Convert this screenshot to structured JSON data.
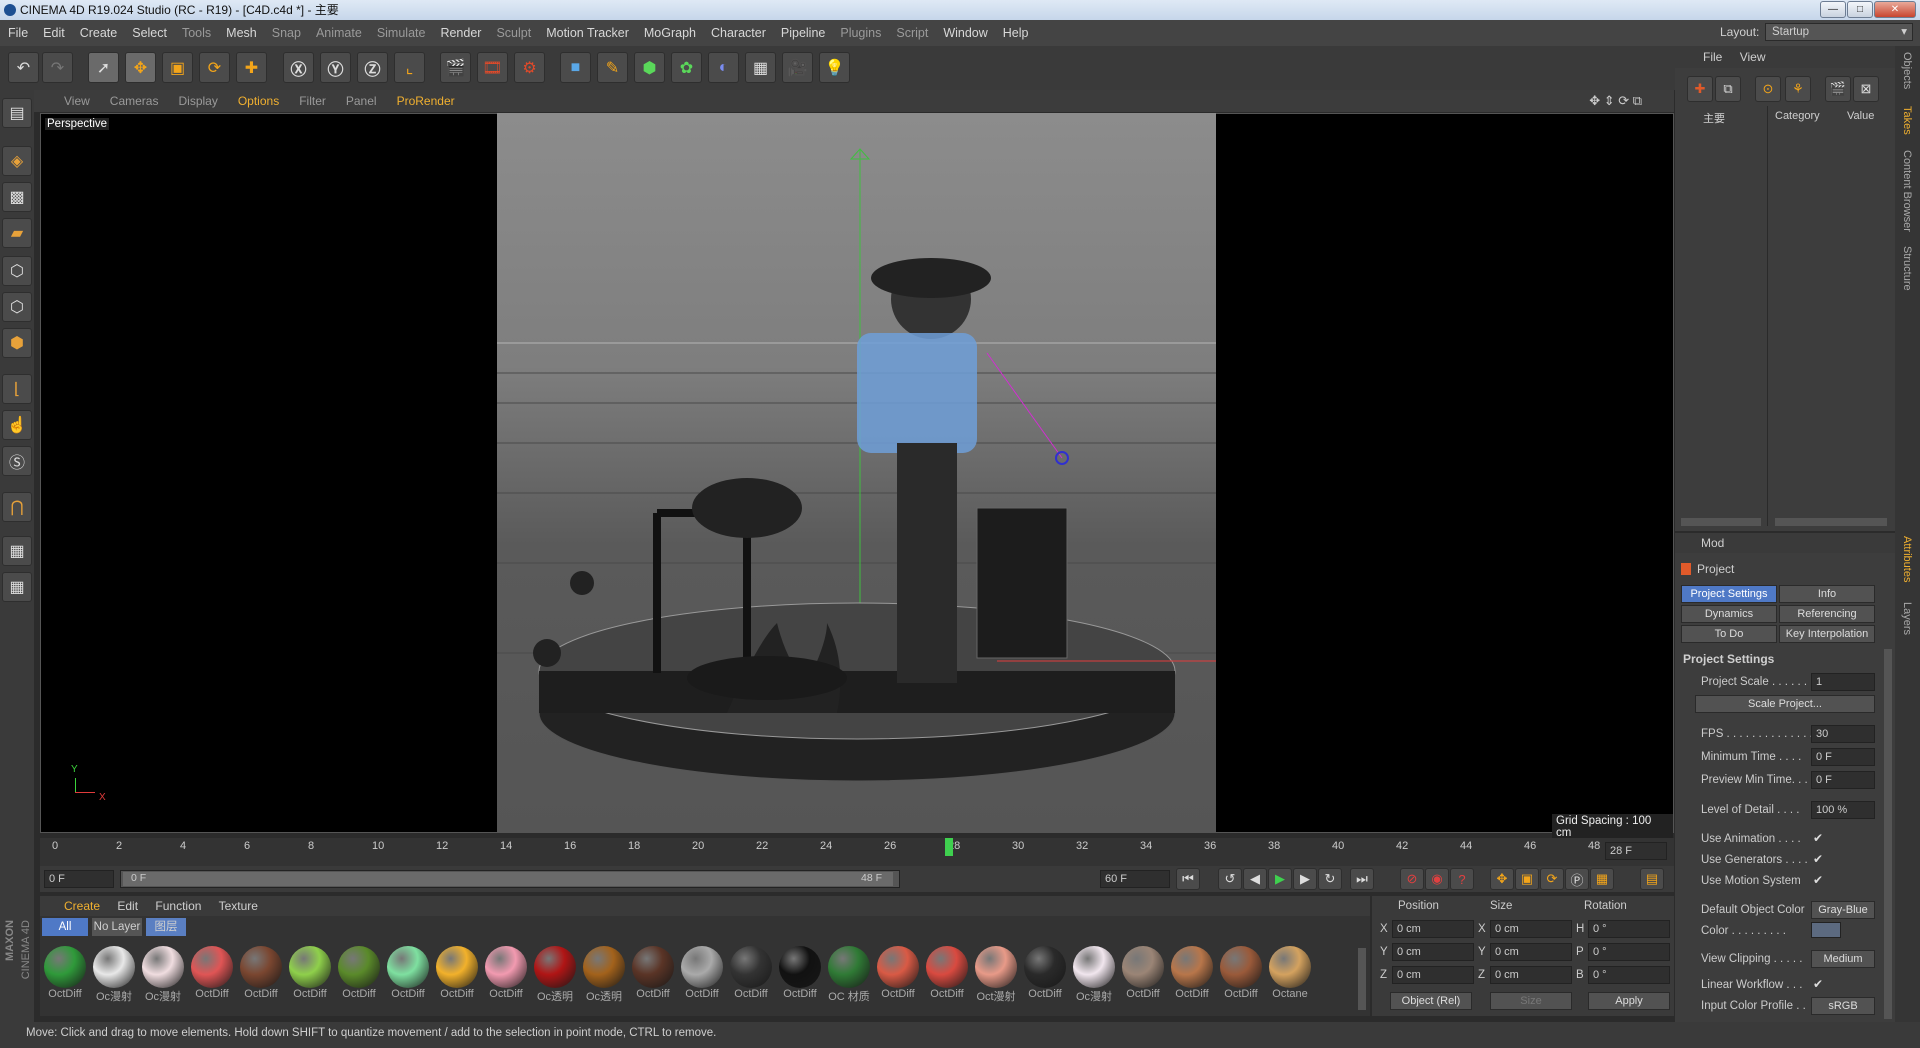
{
  "window": {
    "title": "CINEMA 4D R19.024 Studio (RC - R19) - [C4D.c4d *] - 主要",
    "minimize": "—",
    "maximize": "□",
    "close": "✕"
  },
  "menu": [
    "File",
    "Edit",
    "Create",
    "Select",
    "Tools",
    "Mesh",
    "Snap",
    "Animate",
    "Simulate",
    "Render",
    "Sculpt",
    "Motion Tracker",
    "MoGraph",
    "Character",
    "Pipeline",
    "Plugins",
    "Script",
    "Window",
    "Help"
  ],
  "layout": {
    "label": "Layout:",
    "value": "Startup"
  },
  "viewport_menu": [
    "View",
    "Cameras",
    "Display",
    "Options",
    "Filter",
    "Panel",
    "ProRender"
  ],
  "viewport": {
    "camera": "Perspective",
    "grid_spacing": "Grid Spacing : 100 cm",
    "axis_y": "Y",
    "axis_x": "X"
  },
  "timeline": {
    "ticks": [
      "0",
      "2",
      "4",
      "6",
      "8",
      "10",
      "12",
      "14",
      "16",
      "18",
      "20",
      "22",
      "24",
      "26",
      "28",
      "30",
      "32",
      "34",
      "36",
      "38",
      "40",
      "42",
      "44",
      "46",
      "48"
    ],
    "current": "28 F"
  },
  "transport": {
    "start": "0 F",
    "range_start": "0 F",
    "range_end": "48 F",
    "end": "60 F"
  },
  "materials": {
    "tabs": [
      "Create",
      "Edit",
      "Function",
      "Texture"
    ],
    "filters": [
      "All",
      "No Layer",
      "图层"
    ],
    "items": [
      {
        "label": "OctDiff",
        "color": "#2f9a3a"
      },
      {
        "label": "Oc漫射",
        "color": "#e8e8e8"
      },
      {
        "label": "Oc漫射",
        "color": "#f0dde0"
      },
      {
        "label": "OctDiff",
        "color": "#e05555"
      },
      {
        "label": "OctDiff",
        "color": "#7a4630"
      },
      {
        "label": "OctDiff",
        "color": "#8fd04b"
      },
      {
        "label": "OctDiff",
        "color": "#5a8a2a"
      },
      {
        "label": "OctDiff",
        "color": "#7ee0a0"
      },
      {
        "label": "OctDiff",
        "color": "#f2b12b"
      },
      {
        "label": "OctDiff",
        "color": "#f29ab0"
      },
      {
        "label": "Oc透明",
        "color": "#b01515"
      },
      {
        "label": "Oc透明",
        "color": "#a3621b"
      },
      {
        "label": "OctDiff",
        "color": "#5a3426"
      },
      {
        "label": "OctDiff",
        "color": "#aaaaaa"
      },
      {
        "label": "OctDiff",
        "color": "#333333"
      },
      {
        "label": "OctDiff",
        "color": "#111111"
      },
      {
        "label": "OC 材质",
        "color": "#2f7a35"
      },
      {
        "label": "OctDiff",
        "color": "#d95a45"
      },
      {
        "label": "OctDiff",
        "color": "#d94a40"
      },
      {
        "label": "Oct漫射",
        "color": "#e89a88"
      },
      {
        "label": "OctDiff",
        "color": "#2a2a2a"
      },
      {
        "label": "Oc漫射",
        "color": "#f1e6ee"
      },
      {
        "label": "OctDiff",
        "color": "#9b8576"
      },
      {
        "label": "OctDiff",
        "color": "#b8764a"
      },
      {
        "label": "OctDiff",
        "color": "#9a5a3a"
      },
      {
        "label": "Octane",
        "color": "#d4a25f"
      }
    ]
  },
  "coords": {
    "headers": [
      "Position",
      "Size",
      "Rotation"
    ],
    "rows": [
      {
        "axis": "X",
        "pos": "0 cm",
        "size_axis": "X",
        "size": "0 cm",
        "rot_axis": "H",
        "rot": "0 °"
      },
      {
        "axis": "Y",
        "pos": "0 cm",
        "size_axis": "Y",
        "size": "0 cm",
        "rot_axis": "P",
        "rot": "0 °"
      },
      {
        "axis": "Z",
        "pos": "0 cm",
        "size_axis": "Z",
        "size": "0 cm",
        "rot_axis": "B",
        "rot": "0 °"
      }
    ],
    "mode": "Object (Rel)",
    "size_mode": "Size",
    "apply": "Apply"
  },
  "objects": {
    "menu": [
      "File",
      "View"
    ],
    "item": "主要",
    "col_category": "Category",
    "col_value": "Value"
  },
  "attributes": {
    "mode": "Mod",
    "object": "Project",
    "tabs": [
      "Project Settings",
      "Info",
      "Dynamics",
      "Referencing",
      "To Do",
      "Key Interpolation"
    ],
    "section": "Project Settings",
    "fields": [
      {
        "label": "Project Scale . . . . . .",
        "value": "1"
      },
      {
        "label": "FPS . . . . . . . . . . . . . .",
        "value": "30"
      },
      {
        "label": "Minimum Time . . . .",
        "value": "0 F"
      },
      {
        "label": "Preview Min Time. . .",
        "value": "0 F"
      },
      {
        "label": "Level of Detail . . . .",
        "value": "100 %"
      }
    ],
    "scale_button": "Scale Project...",
    "checks": [
      "Use Animation . . . .",
      "Use Generators . . . .",
      "Use Motion System"
    ],
    "default_color_label": "Default Object Color",
    "default_color_value": "Gray-Blue",
    "color_label": "Color . . . . . . . . .",
    "clipping_label": "View Clipping . . . . .",
    "clipping_value": "Medium",
    "linear_label": "Linear Workflow . . .",
    "profile_label": "Input Color Profile . .",
    "profile_value": "sRGB"
  },
  "vtabs": [
    "Objects",
    "Takes",
    "Content Browser",
    "Structure",
    "Attributes",
    "Layers"
  ],
  "status": "Move: Click and drag to move elements. Hold down SHIFT to quantize movement / add to the selection in point mode, CTRL to remove.",
  "brand": {
    "maxon": "MAXON",
    "c4d": "CINEMA 4D"
  }
}
